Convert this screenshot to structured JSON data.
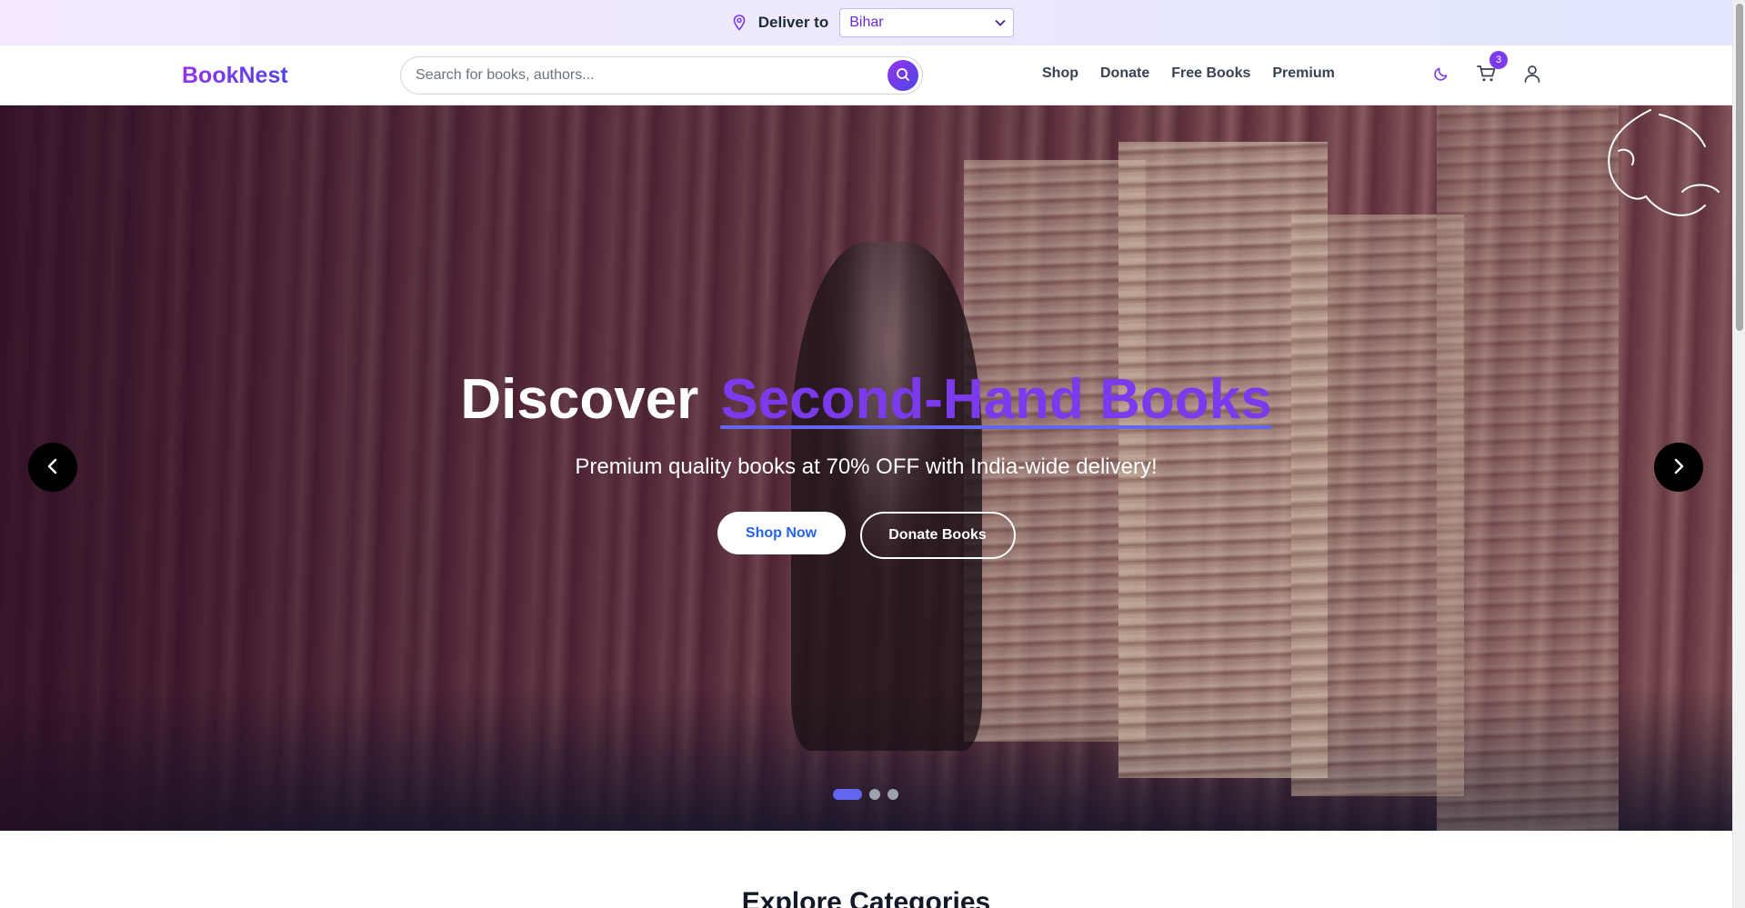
{
  "topbar": {
    "icon": "map-pin-icon",
    "deliver_label": "Deliver to",
    "selected_state": "Bihar"
  },
  "header": {
    "logo": "BookNest",
    "search_placeholder": "Search for books, authors...",
    "nav": [
      {
        "label": "Shop"
      },
      {
        "label": "Donate"
      },
      {
        "label": "Free Books"
      },
      {
        "label": "Premium"
      }
    ],
    "cart_count": "3",
    "icons": [
      "moon-icon",
      "cart-icon",
      "user-icon",
      "search-icon"
    ]
  },
  "hero": {
    "title_plain": "Discover",
    "title_accent": "Second-Hand Books",
    "subtitle": "Premium quality books at 70% OFF with India-wide delivery!",
    "primary_button": "Shop Now",
    "secondary_button": "Donate Books",
    "slide_count": 3,
    "active_slide": 1
  },
  "section": {
    "title": "Explore Categories"
  },
  "colors": {
    "accent": "#7c3aed",
    "accent_secondary": "#4f46e5",
    "primary_button_text": "#2563eb",
    "topbar_bg": "#ede9fe"
  }
}
